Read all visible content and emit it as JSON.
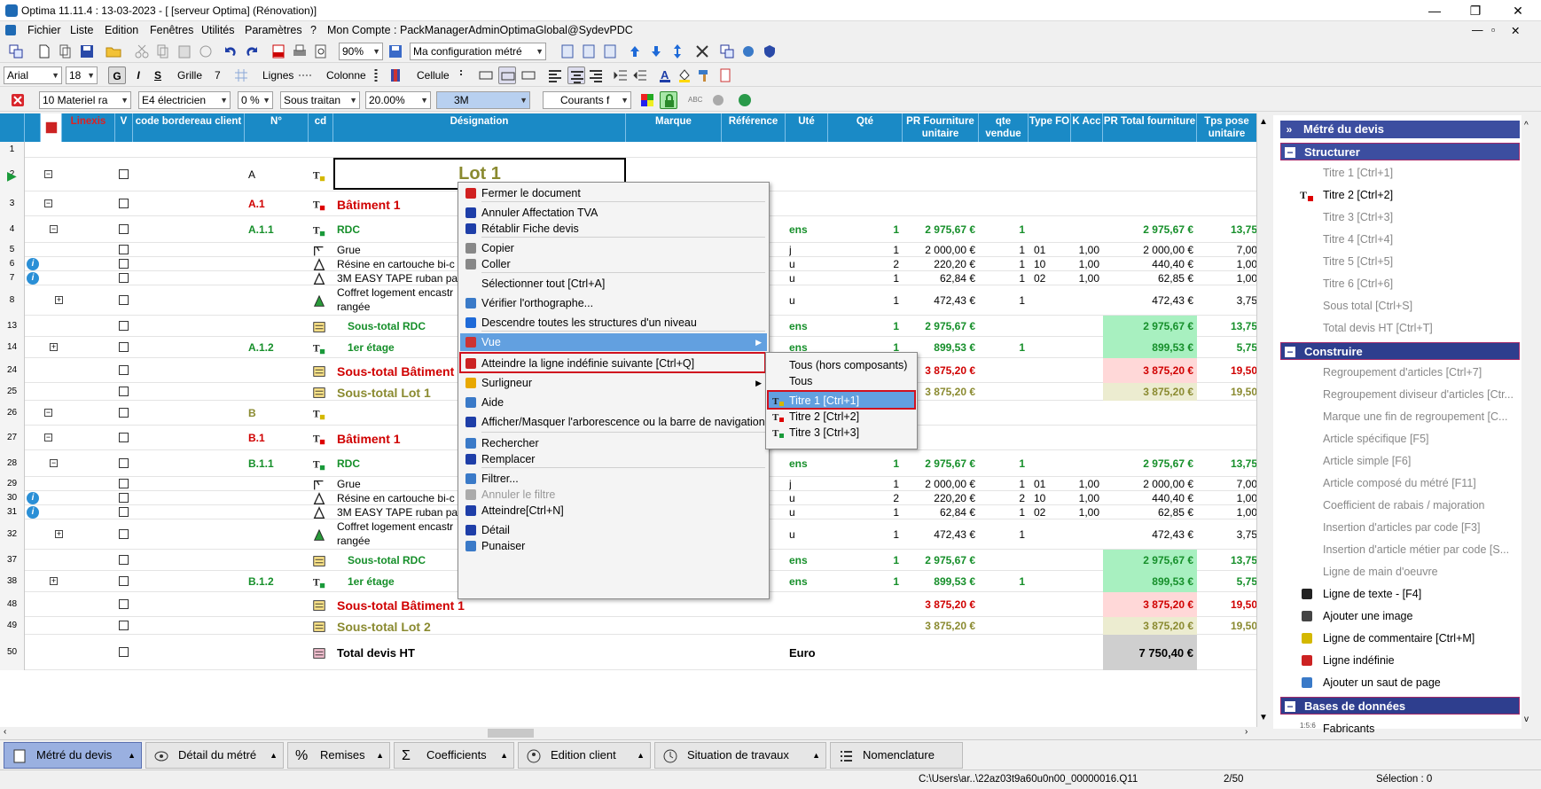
{
  "window": {
    "title": "Optima 11.11.4 : 13-03-2023 - [ [serveur Optima] (Rénovation)]",
    "min": "—",
    "max": "❐",
    "close": "✕"
  },
  "menu": {
    "items": [
      "Fichier",
      "Liste",
      "Edition",
      "Fenêtres",
      "Utilités",
      "Paramètres",
      "?",
      "Mon Compte : PackManagerAdminOptimaGlobal@SydevPDC"
    ],
    "mdi": [
      "—",
      "▫",
      "✕"
    ]
  },
  "toolbar1": {
    "zoom": "90%",
    "config": "Ma configuration métré"
  },
  "toolbar2": {
    "font": "Arial",
    "size": "18",
    "bold": "G",
    "italic": "I",
    "underline": "S",
    "grille": "Grille",
    "grille_val": "7",
    "lignes": "Lignes",
    "colonne": "Colonne",
    "cellule": "Cellule"
  },
  "toolbar3": {
    "materiel": "10  Materiel ra",
    "electricien": "E4  électricien",
    "pct": "0 %",
    "sous_traitan": "Sous traitan",
    "rate": "20.00%",
    "brand": "3M",
    "courants": "Courants f"
  },
  "grid": {
    "headers": [
      "Linexis",
      "V",
      "code bordereau client",
      "N°",
      "cd",
      "Désignation",
      "Marque",
      "Référence",
      "Uté",
      "Qté",
      "PR Fourniture unitaire",
      "qte vendue",
      "Type FO",
      "K Acc",
      "PR Total fourniture",
      "Tps pose unitaire"
    ],
    "lot1_label": "Lot 1",
    "rows": [
      {
        "n": "1"
      },
      {
        "n": "2",
        "num": "A"
      },
      {
        "n": "3",
        "num": "A.1",
        "des": "Bâtiment 1"
      },
      {
        "n": "4",
        "num": "A.1.1",
        "des": "RDC",
        "ute": "ens",
        "qte": "1",
        "pru": "2 975,67 €",
        "qv": "1",
        "prt": "2 975,67 €",
        "tps": "13,75"
      },
      {
        "n": "5",
        "des": "Grue",
        "ute": "j",
        "qte": "1",
        "pru": "2 000,00 €",
        "qv": "1",
        "type": "01",
        "k": "1,00",
        "prt": "2 000,00 €",
        "tps": "7,00"
      },
      {
        "n": "6",
        "des": "Résine en cartouche bi-c",
        "ute": "u",
        "qte": "2",
        "pru": "220,20 €",
        "qv": "1",
        "type": "10",
        "k": "1,00",
        "prt": "440,40 €",
        "tps": "1,00"
      },
      {
        "n": "7",
        "des": "3M EASY TAPE ruban pa",
        "ute": "u",
        "qte": "1",
        "pru": "62,84 €",
        "qv": "1",
        "type": "02",
        "k": "1,00",
        "prt": "62,85 €",
        "tps": "1,00"
      },
      {
        "n": "8",
        "des": "Coffret logement encastr",
        "des2": "rangée",
        "ute": "u",
        "qte": "1",
        "pru": "472,43 €",
        "qv": "1",
        "prt": "472,43 €",
        "tps": "3,75"
      },
      {
        "n": "13",
        "des": "Sous-total RDC",
        "ute": "ens",
        "qte": "1",
        "pru": "2 975,67 €",
        "prt": "2 975,67 €",
        "tps": "13,75"
      },
      {
        "n": "14",
        "num": "A.1.2",
        "des": "1er étage",
        "ute": "ens",
        "qte": "1",
        "pru": "899,53 €",
        "qv": "1",
        "prt": "899,53 €",
        "tps": "5,75"
      },
      {
        "n": "24",
        "des": "Sous-total Bâtiment 1",
        "pru": "3 875,20 €",
        "prt": "3 875,20 €",
        "tps": "19,50"
      },
      {
        "n": "25",
        "des": "Sous-total Lot 1",
        "pru": "3 875,20 €",
        "prt": "3 875,20 €",
        "tps": "19,50"
      },
      {
        "n": "26",
        "num": "B"
      },
      {
        "n": "27",
        "num": "B.1",
        "des": "Bâtiment 1"
      },
      {
        "n": "28",
        "num": "B.1.1",
        "des": "RDC",
        "ute": "ens",
        "qte": "1",
        "pru": "2 975,67 €",
        "qv": "1",
        "prt": "2 975,67 €",
        "tps": "13,75"
      },
      {
        "n": "29",
        "des": "Grue",
        "ute": "j",
        "qte": "1",
        "pru": "2 000,00 €",
        "qv": "1",
        "type": "01",
        "k": "1,00",
        "prt": "2 000,00 €",
        "tps": "7,00"
      },
      {
        "n": "30",
        "des": "Résine en cartouche bi-c",
        "ute": "u",
        "qte": "2",
        "pru": "220,20 €",
        "qv": "2",
        "type": "10",
        "k": "1,00",
        "prt": "440,40 €",
        "tps": "1,00"
      },
      {
        "n": "31",
        "des": "3M EASY TAPE ruban pa",
        "ute": "u",
        "qte": "1",
        "pru": "62,84 €",
        "qv": "1",
        "type": "02",
        "k": "1,00",
        "prt": "62,85 €",
        "tps": "1,00"
      },
      {
        "n": "32",
        "des": "Coffret logement encastr",
        "des2": "rangée",
        "ute": "u",
        "qte": "1",
        "pru": "472,43 €",
        "qv": "1",
        "prt": "472,43 €",
        "tps": "3,75"
      },
      {
        "n": "37",
        "des": "Sous-total RDC",
        "ute": "ens",
        "qte": "1",
        "pru": "2 975,67 €",
        "prt": "2 975,67 €",
        "tps": "13,75"
      },
      {
        "n": "38",
        "num": "B.1.2",
        "des": "1er étage",
        "ute": "ens",
        "qte": "1",
        "pru": "899,53 €",
        "qv": "1",
        "prt": "899,53 €",
        "tps": "5,75"
      },
      {
        "n": "48",
        "des": "Sous-total Bâtiment 1",
        "pru": "3 875,20 €",
        "prt": "3 875,20 €",
        "tps": "19,50"
      },
      {
        "n": "49",
        "des": "Sous-total Lot 2",
        "pru": "3 875,20 €",
        "prt": "3 875,20 €",
        "tps": "19,50"
      },
      {
        "n": "50",
        "des": "Total devis HT",
        "ute": "Euro",
        "prt": "7 750,40 €"
      }
    ]
  },
  "context_menu": {
    "items": [
      "Fermer le document",
      "Annuler Affectation TVA",
      "Rétablir Fiche devis",
      "Copier",
      "Coller",
      "Sélectionner tout [Ctrl+A]",
      "Vérifier l'orthographe...",
      "Descendre toutes les structures d'un niveau",
      "Vue",
      "Atteindre la ligne indéfinie suivante [Ctrl+Q]",
      "Surligneur",
      "Aide",
      "Afficher/Masquer l'arborescence ou la barre de navigation",
      "Rechercher",
      "Remplacer",
      "Filtrer...",
      "Annuler le filtre",
      "Atteindre[Ctrl+N]",
      "Détail",
      "Punaiser"
    ]
  },
  "submenu": {
    "items": [
      "Tous (hors composants)",
      "Tous",
      "Titre 1 [Ctrl+1]",
      "Titre 2 [Ctrl+2]",
      "Titre 3 [Ctrl+3]"
    ]
  },
  "right_panel": {
    "header": "Métré du devis",
    "sec1": "Structurer",
    "structurer": [
      "Titre 1 [Ctrl+1]",
      "Titre 2 [Ctrl+2]",
      "Titre 3 [Ctrl+3]",
      "Titre 4 [Ctrl+4]",
      "Titre 5 [Ctrl+5]",
      "Titre 6 [Ctrl+6]",
      "Sous total [Ctrl+S]",
      "Total devis HT [Ctrl+T]"
    ],
    "sec2": "Construire",
    "construire": [
      "Regroupement d'articles  [Ctrl+7]",
      "Regroupement diviseur d'articles [Ctr...",
      "Marque une fin de regroupement    [C...",
      "Article spécifique [F5]",
      "Article simple [F6]",
      "Article composé du métré [F11]",
      "Coefficient de rabais / majoration",
      "Insertion d'articles par code [F3]",
      "Insertion d'article métier par code [S...",
      "Ligne de main d'oeuvre",
      "Ligne de texte - [F4]",
      "Ajouter une image",
      "Ligne de commentaire [Ctrl+M]",
      "Ligne indéfinie",
      "Ajouter un saut de page"
    ],
    "sec3": "Bases de données",
    "fabricants": "Fabricants"
  },
  "tabs": [
    "Métré du devis",
    "Détail du métré",
    "Remises",
    "Coefficients",
    "Edition client",
    "Situation de travaux",
    "Nomenclature"
  ],
  "status": {
    "path": "C:\\Users\\ar..\\22az03t9a60u0n00_00000016.Q11",
    "page": "2/50",
    "selection": "Sélection : 0"
  }
}
